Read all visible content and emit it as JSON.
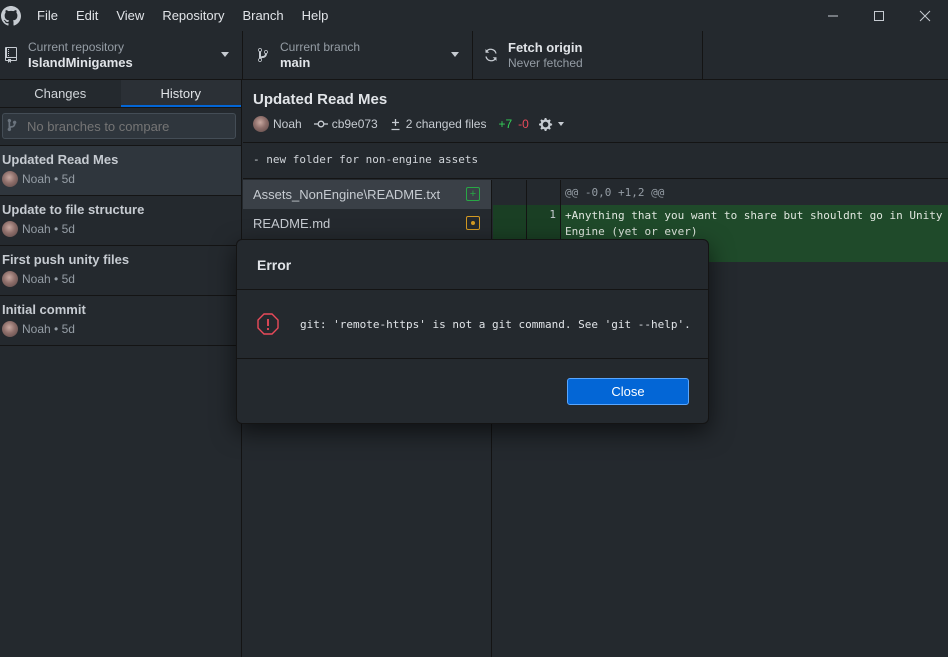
{
  "titlebar": {
    "logo_icon": "github-logo-icon",
    "menu": [
      "File",
      "Edit",
      "View",
      "Repository",
      "Branch",
      "Help"
    ],
    "controls": [
      "minimize-icon",
      "maximize-icon",
      "close-icon"
    ]
  },
  "toolbar": {
    "repository": {
      "sub": "Current repository",
      "main": "IslandMinigames",
      "icon": "repo-icon"
    },
    "branch": {
      "sub": "Current branch",
      "main": "main",
      "icon": "branch-icon"
    },
    "fetch": {
      "sub": "Never fetched",
      "main": "Fetch origin",
      "icon": "sync-icon"
    }
  },
  "sidebar": {
    "tabs": [
      {
        "label": "Changes",
        "selected": false
      },
      {
        "label": "History",
        "selected": true
      }
    ],
    "compare": {
      "placeholder": "No branches to compare"
    },
    "commits": [
      {
        "title": "Updated Read Mes",
        "author": "Noah",
        "age": "5d",
        "selected": true
      },
      {
        "title": "Update to file structure",
        "author": "Noah",
        "age": "5d",
        "selected": false
      },
      {
        "title": "First push unity files",
        "author": "Noah",
        "age": "5d",
        "selected": false
      },
      {
        "title": "Initial commit",
        "author": "Noah",
        "age": "5d",
        "selected": false
      }
    ]
  },
  "commit_detail": {
    "title": "Updated Read Mes",
    "author": "Noah",
    "sha": "cb9e073",
    "changed_files": "2 changed files",
    "additions": "+7",
    "deletions": "-0",
    "body": "- new folder for non-engine assets",
    "files": [
      {
        "path": "Assets_NonEngine\\README.txt",
        "status": "added",
        "selected": true
      },
      {
        "path": "README.md",
        "status": "modified",
        "selected": false
      }
    ],
    "diff": {
      "hunk": "@@ -0,0 +1,2 @@",
      "lines": [
        {
          "num": "1",
          "text": "+Anything that you want to share but shouldnt go in Unity Engine (yet or ever)"
        }
      ]
    }
  },
  "dialog": {
    "title": "Error",
    "message": "git: 'remote-https' is not a git command. See 'git --help'.",
    "button": "Close",
    "icon": "error-icon"
  },
  "colors": {
    "accent": "#0366d6",
    "added": "#28a745",
    "modified": "#d29922",
    "error": "#ea4a5a"
  }
}
